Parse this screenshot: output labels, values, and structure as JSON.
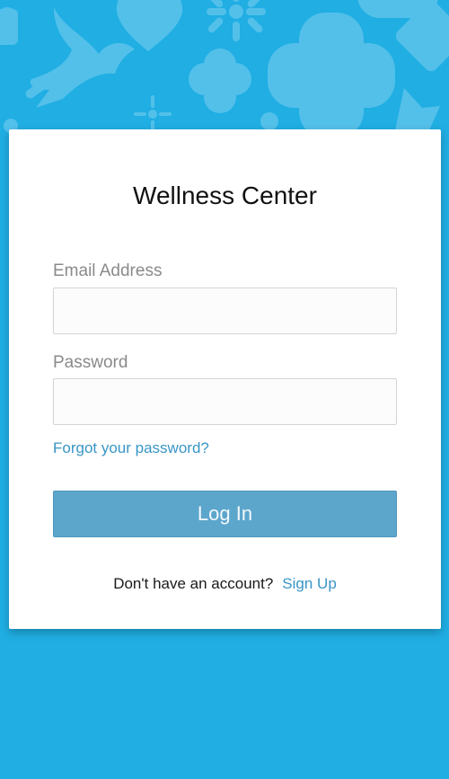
{
  "app": {
    "title": "Wellness Center"
  },
  "form": {
    "email": {
      "label": "Email Address",
      "value": "",
      "placeholder": ""
    },
    "password": {
      "label": "Password",
      "value": "",
      "placeholder": ""
    },
    "forgot_link": "Forgot your password?",
    "login_button": "Log In"
  },
  "signup": {
    "prompt": "Don't have an account?",
    "link": "Sign Up"
  },
  "colors": {
    "background": "#20aee3",
    "pattern": "#5cc4ec",
    "card": "#ffffff",
    "button": "#5ca6cc",
    "link": "#3a95c6"
  },
  "background_icons": [
    "bird-icon",
    "heart-icon",
    "flower-icon",
    "medical-cross-icon",
    "bell-icon",
    "pill-icon"
  ]
}
